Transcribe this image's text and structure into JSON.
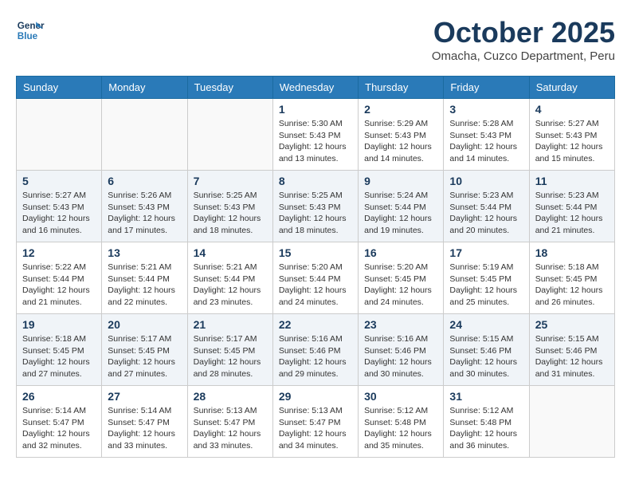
{
  "header": {
    "logo_line1": "General",
    "logo_line2": "Blue",
    "month_title": "October 2025",
    "location": "Omacha, Cuzco Department, Peru"
  },
  "days_of_week": [
    "Sunday",
    "Monday",
    "Tuesday",
    "Wednesday",
    "Thursday",
    "Friday",
    "Saturday"
  ],
  "weeks": [
    [
      {
        "day": "",
        "info": ""
      },
      {
        "day": "",
        "info": ""
      },
      {
        "day": "",
        "info": ""
      },
      {
        "day": "1",
        "info": "Sunrise: 5:30 AM\nSunset: 5:43 PM\nDaylight: 12 hours\nand 13 minutes."
      },
      {
        "day": "2",
        "info": "Sunrise: 5:29 AM\nSunset: 5:43 PM\nDaylight: 12 hours\nand 14 minutes."
      },
      {
        "day": "3",
        "info": "Sunrise: 5:28 AM\nSunset: 5:43 PM\nDaylight: 12 hours\nand 14 minutes."
      },
      {
        "day": "4",
        "info": "Sunrise: 5:27 AM\nSunset: 5:43 PM\nDaylight: 12 hours\nand 15 minutes."
      }
    ],
    [
      {
        "day": "5",
        "info": "Sunrise: 5:27 AM\nSunset: 5:43 PM\nDaylight: 12 hours\nand 16 minutes."
      },
      {
        "day": "6",
        "info": "Sunrise: 5:26 AM\nSunset: 5:43 PM\nDaylight: 12 hours\nand 17 minutes."
      },
      {
        "day": "7",
        "info": "Sunrise: 5:25 AM\nSunset: 5:43 PM\nDaylight: 12 hours\nand 18 minutes."
      },
      {
        "day": "8",
        "info": "Sunrise: 5:25 AM\nSunset: 5:43 PM\nDaylight: 12 hours\nand 18 minutes."
      },
      {
        "day": "9",
        "info": "Sunrise: 5:24 AM\nSunset: 5:44 PM\nDaylight: 12 hours\nand 19 minutes."
      },
      {
        "day": "10",
        "info": "Sunrise: 5:23 AM\nSunset: 5:44 PM\nDaylight: 12 hours\nand 20 minutes."
      },
      {
        "day": "11",
        "info": "Sunrise: 5:23 AM\nSunset: 5:44 PM\nDaylight: 12 hours\nand 21 minutes."
      }
    ],
    [
      {
        "day": "12",
        "info": "Sunrise: 5:22 AM\nSunset: 5:44 PM\nDaylight: 12 hours\nand 21 minutes."
      },
      {
        "day": "13",
        "info": "Sunrise: 5:21 AM\nSunset: 5:44 PM\nDaylight: 12 hours\nand 22 minutes."
      },
      {
        "day": "14",
        "info": "Sunrise: 5:21 AM\nSunset: 5:44 PM\nDaylight: 12 hours\nand 23 minutes."
      },
      {
        "day": "15",
        "info": "Sunrise: 5:20 AM\nSunset: 5:44 PM\nDaylight: 12 hours\nand 24 minutes."
      },
      {
        "day": "16",
        "info": "Sunrise: 5:20 AM\nSunset: 5:45 PM\nDaylight: 12 hours\nand 24 minutes."
      },
      {
        "day": "17",
        "info": "Sunrise: 5:19 AM\nSunset: 5:45 PM\nDaylight: 12 hours\nand 25 minutes."
      },
      {
        "day": "18",
        "info": "Sunrise: 5:18 AM\nSunset: 5:45 PM\nDaylight: 12 hours\nand 26 minutes."
      }
    ],
    [
      {
        "day": "19",
        "info": "Sunrise: 5:18 AM\nSunset: 5:45 PM\nDaylight: 12 hours\nand 27 minutes."
      },
      {
        "day": "20",
        "info": "Sunrise: 5:17 AM\nSunset: 5:45 PM\nDaylight: 12 hours\nand 27 minutes."
      },
      {
        "day": "21",
        "info": "Sunrise: 5:17 AM\nSunset: 5:45 PM\nDaylight: 12 hours\nand 28 minutes."
      },
      {
        "day": "22",
        "info": "Sunrise: 5:16 AM\nSunset: 5:46 PM\nDaylight: 12 hours\nand 29 minutes."
      },
      {
        "day": "23",
        "info": "Sunrise: 5:16 AM\nSunset: 5:46 PM\nDaylight: 12 hours\nand 30 minutes."
      },
      {
        "day": "24",
        "info": "Sunrise: 5:15 AM\nSunset: 5:46 PM\nDaylight: 12 hours\nand 30 minutes."
      },
      {
        "day": "25",
        "info": "Sunrise: 5:15 AM\nSunset: 5:46 PM\nDaylight: 12 hours\nand 31 minutes."
      }
    ],
    [
      {
        "day": "26",
        "info": "Sunrise: 5:14 AM\nSunset: 5:47 PM\nDaylight: 12 hours\nand 32 minutes."
      },
      {
        "day": "27",
        "info": "Sunrise: 5:14 AM\nSunset: 5:47 PM\nDaylight: 12 hours\nand 33 minutes."
      },
      {
        "day": "28",
        "info": "Sunrise: 5:13 AM\nSunset: 5:47 PM\nDaylight: 12 hours\nand 33 minutes."
      },
      {
        "day": "29",
        "info": "Sunrise: 5:13 AM\nSunset: 5:47 PM\nDaylight: 12 hours\nand 34 minutes."
      },
      {
        "day": "30",
        "info": "Sunrise: 5:12 AM\nSunset: 5:48 PM\nDaylight: 12 hours\nand 35 minutes."
      },
      {
        "day": "31",
        "info": "Sunrise: 5:12 AM\nSunset: 5:48 PM\nDaylight: 12 hours\nand 36 minutes."
      },
      {
        "day": "",
        "info": ""
      }
    ]
  ]
}
